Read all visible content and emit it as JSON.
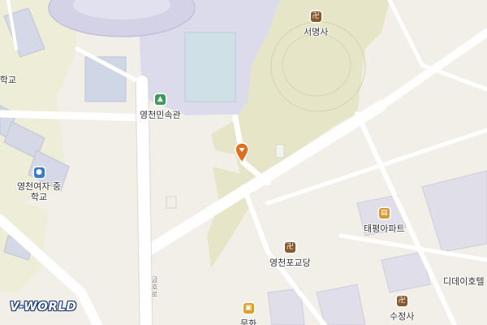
{
  "map": {
    "pois": [
      {
        "name": "서명사",
        "icon": "buddhist-temple-icon"
      },
      {
        "name": "영천민속관",
        "icon": "museum-icon"
      },
      {
        "name": "영천여자 중학교",
        "icon": "school-icon"
      },
      {
        "name": "여자 학교",
        "icon": "school-icon"
      },
      {
        "name": "태평아파트",
        "icon": "apartment-icon"
      },
      {
        "name": "영천포교당",
        "icon": "buddhist-temple-icon"
      },
      {
        "name": "디데이호텔",
        "icon": "hotel-icon"
      },
      {
        "name": "수정사",
        "icon": "buddhist-temple-icon"
      },
      {
        "name": "문화",
        "icon": "shop-icon"
      }
    ],
    "road_labels": [
      "금호로"
    ],
    "marker": {
      "icon": "location-pin-icon",
      "color": "#e07020"
    },
    "logo": {
      "text": "V-WORLD"
    },
    "colors": {
      "background": "#f2efe9",
      "park": "#e6e5c8",
      "sports": "#dcdbec",
      "school_area": "#eeeed8",
      "building": "#d8d8e0",
      "road": "#ffffff"
    }
  }
}
